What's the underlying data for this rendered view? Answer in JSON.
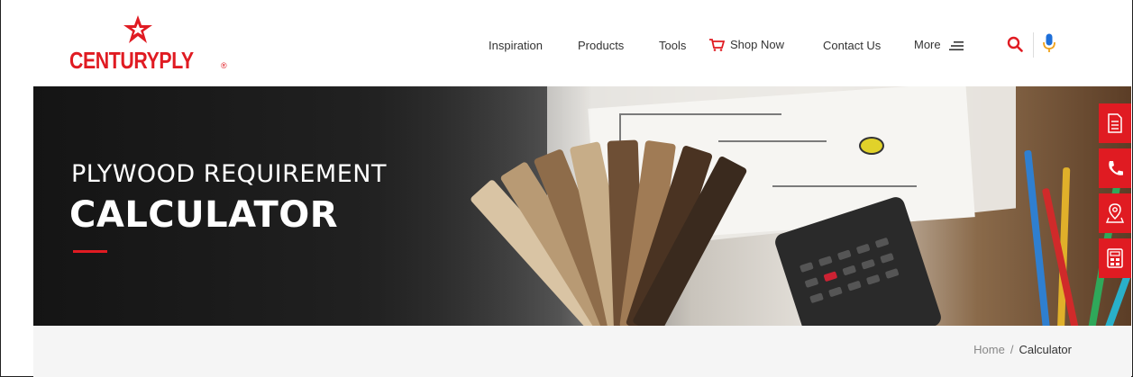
{
  "brand": {
    "name": "CENTURYPLY",
    "registered": "®",
    "color": "#e01b22"
  },
  "nav": {
    "items": [
      {
        "label": "Inspiration"
      },
      {
        "label": "Products"
      },
      {
        "label": "Tools"
      },
      {
        "label": "Shop Now",
        "icon": "cart-icon"
      },
      {
        "label": "Contact Us"
      },
      {
        "label": "More",
        "icon": "menu-lines-icon"
      }
    ],
    "search_icon": "search-icon",
    "mic_icon": "microphone-icon"
  },
  "hero": {
    "title_line1": "PLYWOOD REQUIREMENT",
    "title_line2": "CALCULATOR",
    "accent_color": "#e01b22"
  },
  "side_actions": [
    {
      "icon": "document-list-icon"
    },
    {
      "icon": "phone-icon"
    },
    {
      "icon": "location-pin-icon"
    },
    {
      "icon": "calculator-icon"
    }
  ],
  "breadcrumb": {
    "home": "Home",
    "separator": "/",
    "current": "Calculator"
  }
}
